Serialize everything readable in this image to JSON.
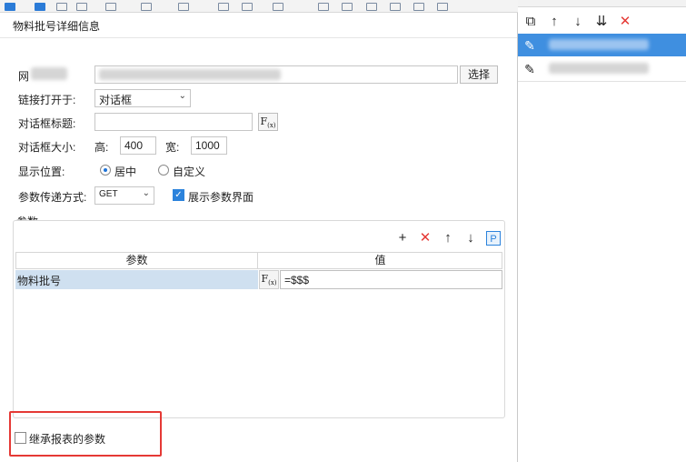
{
  "dialog": {
    "title": "物料批号详细信息",
    "url": {
      "label": "网",
      "select_button": "选择"
    },
    "open_in": {
      "label": "链接打开于:",
      "value": "对话框"
    },
    "dialog_title": {
      "label": "对话框标题:",
      "value": ""
    },
    "dialog_size": {
      "label": "对话框大小:",
      "height_label": "高:",
      "height_value": "400",
      "width_label": "宽:",
      "width_value": "1000"
    },
    "position": {
      "label": "显示位置:",
      "options": [
        "居中",
        "自定义"
      ],
      "selected": "居中"
    },
    "param_method": {
      "label": "参数传递方式:",
      "value": "GET",
      "show_params_label": "展示参数界面",
      "show_params_checked": true
    },
    "params_group": {
      "title": "参数",
      "columns": [
        "参数",
        "值"
      ],
      "rows": [
        {
          "param": "物料批号",
          "value": "=$$$"
        }
      ],
      "toolbar": {
        "add": "+",
        "delete": "✕",
        "up": "↑",
        "down": "↓",
        "p": "P"
      }
    },
    "inherit_params": {
      "label": "继承报表的参数",
      "checked": false
    },
    "formula_button": "F",
    "formula_sub": "(x)"
  },
  "right_panel": {
    "toolbar": {
      "copy": "⧉",
      "up": "↑",
      "down": "↓",
      "sort": "⇊",
      "delete": "✕"
    },
    "items": [
      {
        "selected": true
      },
      {
        "selected": false
      }
    ]
  },
  "colors": {
    "accent": "#2c83dc",
    "selection_row": "#cfe0f0",
    "selected_item": "#3f8fe0",
    "danger": "#e53935"
  }
}
